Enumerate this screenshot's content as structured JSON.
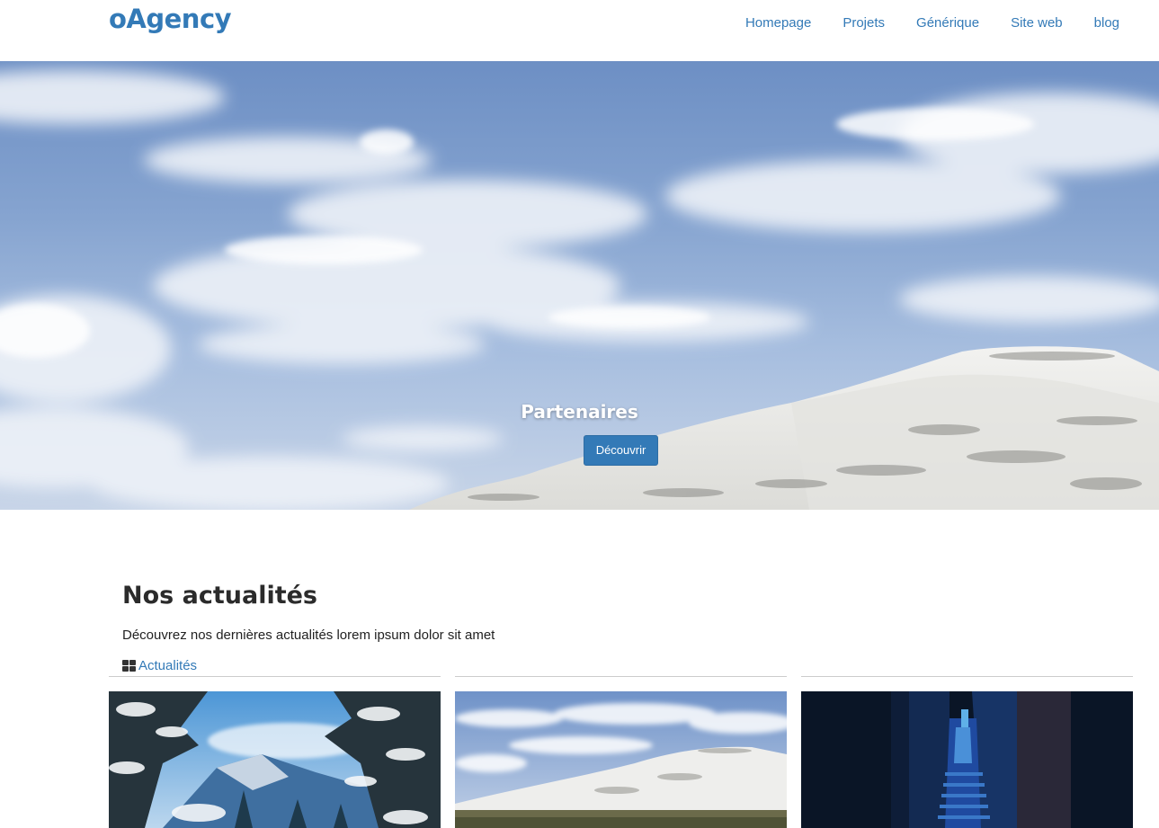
{
  "header": {
    "logo": "oAgency",
    "nav": [
      "Homepage",
      "Projets",
      "Générique",
      "Site web",
      "blog"
    ]
  },
  "hero": {
    "title": "Partenaires",
    "button": "Découvrir"
  },
  "news": {
    "title": "Nos actualités",
    "subtitle": "Découvrez nos dernières actualités lorem ipsum dolor sit amet",
    "category": "Actualités"
  },
  "colors": {
    "accent": "#337ab7",
    "heading": "#2b2b2b"
  },
  "icons": {
    "category": "grid-icon"
  }
}
